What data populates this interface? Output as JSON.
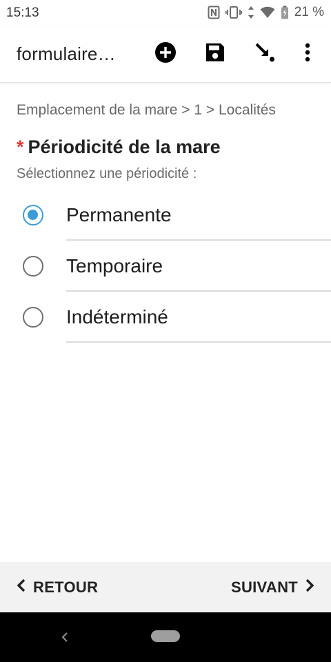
{
  "status_bar": {
    "time": "15:13",
    "battery_percent": "21 %",
    "icons": [
      "nfc-icon",
      "vibrate-icon",
      "data-arrows-icon",
      "wifi-icon",
      "battery-charging-icon"
    ]
  },
  "app_bar": {
    "title": "formulaire…",
    "actions": [
      "add-circle-icon",
      "save-icon",
      "jump-arrow-icon",
      "more-vert-icon"
    ]
  },
  "breadcrumb": "Emplacement de la mare > 1 > Localités",
  "question": {
    "required_marker": "*",
    "label": "Périodicité de la mare",
    "hint": "Sélectionnez une périodicité :",
    "options": [
      {
        "label": "Permanente",
        "selected": true
      },
      {
        "label": "Temporaire",
        "selected": false
      },
      {
        "label": "Indéterminé",
        "selected": false
      }
    ]
  },
  "bottom_nav": {
    "back_label": "RETOUR",
    "next_label": "SUIVANT"
  },
  "colors": {
    "accent": "#3d9bd6",
    "required": "#e53935",
    "bottom_bar": "#f2f2f2",
    "system_nav": "#000000"
  }
}
